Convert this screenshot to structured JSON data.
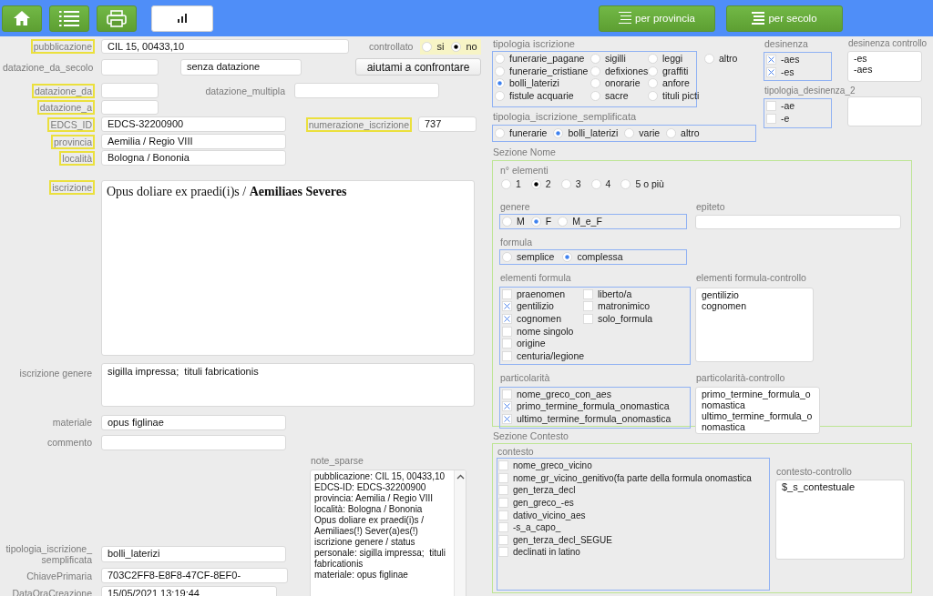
{
  "toolbar": {
    "buttons": [
      {
        "label": "per provincia"
      },
      {
        "label": "per secolo"
      }
    ]
  },
  "fields": {
    "pubblicazione": {
      "label": "pubblicazione",
      "flagged": true,
      "value": "CIL 15, 00433,10"
    },
    "controllato": {
      "label": "controllato",
      "options": [
        {
          "label": "si",
          "selected": false
        },
        {
          "label": "no",
          "selected": true
        }
      ]
    },
    "datazione_da_secolo": {
      "label": "datazione_da_secolo",
      "flagged": false,
      "extra_value": "senza datazione"
    },
    "confronta_button": "aiutami a confrontare",
    "datazione_da": {
      "label": "datazione_da",
      "flagged": true
    },
    "datazione_multipla": {
      "label": "datazione_multipla",
      "flagged": false
    },
    "datazione_a": {
      "label": "datazione_a",
      "flagged": true
    },
    "EDCS_ID": {
      "label": "EDCS_ID",
      "flagged": true,
      "value": "EDCS-32200900"
    },
    "numerazione_iscrizione": {
      "label": "numerazione_iscrizione",
      "flagged": true,
      "value": "737"
    },
    "provincia": {
      "label": "provincia",
      "flagged": true,
      "value": "Aemilia / Regio VIII"
    },
    "localita": {
      "label": "località",
      "flagged": true,
      "value": "Bologna / Bononia"
    },
    "iscrizione": {
      "label": "iscrizione",
      "flagged": true,
      "value": "Opus doliare ex praedi(i)s / **Aemiliaes Severes**"
    },
    "iscrizione_genere": {
      "label": "iscrizione genere",
      "flagged": false,
      "value": "sigilla impressa;  tituli fabricationis"
    },
    "materiale": {
      "label": "materiale",
      "flagged": false,
      "value": "opus figlinae"
    },
    "commento": {
      "label": "commento",
      "flagged": false
    },
    "note_sparse": {
      "label": "note_sparse",
      "value": "pubblicazione: CIL 15, 00433,10\tEDCS-ID: EDCS-32200900\nprovincia: Aemilia / Regio VIII\tlocalità: Bologna / Bononia\nOpus doliare ex praedi(i)s / Aemiliaes(!) Sever(a)es(!)\niscrizione genere / status personale: sigilla impressa;  tituli fabricationis\nmateriale: opus figlinae"
    },
    "tipologia_iscrizione_semplificata": {
      "label": "tipologia_iscrizione_semplificata",
      "flagged": false,
      "value": "bolli_laterizi"
    },
    "ChiavePrimaria": {
      "label": "ChiavePrimaria",
      "flagged": false,
      "value": "703C2FF8-E8F8-47CF-8EF0-"
    },
    "DataOraCreazione": {
      "label": "DataOraCreazione",
      "flagged": false,
      "value": "15/05/2021 13:19:44"
    }
  },
  "classificazione": {
    "tipologia_iscrizione": {
      "label": "tipologia iscrizione",
      "options": [
        {
          "label": "funerarie_pagane",
          "selected": false
        },
        {
          "label": "funerarie_cristiane",
          "selected": false
        },
        {
          "label": "bolli_laterizi",
          "selected": true
        },
        {
          "label": "fistule acquarie",
          "selected": false
        },
        {
          "label": "sigilli",
          "selected": false
        },
        {
          "label": "defixiones",
          "selected": false
        },
        {
          "label": "onorarie",
          "selected": false
        },
        {
          "label": "sacre",
          "selected": false
        },
        {
          "label": "leggi",
          "selected": false
        },
        {
          "label": "graffiti",
          "selected": false
        },
        {
          "label": "anfore",
          "selected": false
        },
        {
          "label": "tituli picti",
          "selected": false
        },
        {
          "label": "altro",
          "selected": false
        }
      ]
    },
    "tipologia_iscrizione_semplificata": {
      "label": "tipologia_iscrizione_semplificata",
      "options": [
        {
          "label": "funerarie",
          "selected": false
        },
        {
          "label": "bolli_laterizi",
          "selected": true
        },
        {
          "label": "varie",
          "selected": false
        },
        {
          "label": "altro",
          "selected": false
        }
      ]
    },
    "desinenza": {
      "label": "desinenza",
      "options": [
        {
          "label": "-aes",
          "checked": true
        },
        {
          "label": "-es",
          "checked": true
        }
      ]
    },
    "desinenza_controllo": {
      "label": "desinenza controllo",
      "lines": [
        "-es",
        "-aes"
      ]
    },
    "tipologia_desinenza_2": {
      "label": "tipologia_desinenza_2",
      "options": [
        {
          "label": "-ae",
          "checked": false
        },
        {
          "label": "-e",
          "checked": false
        }
      ]
    }
  },
  "sezione_nome": {
    "title": "Sezione Nome",
    "n_elementi": {
      "label": "n° elementi",
      "options": [
        {
          "label": "1",
          "selected": false
        },
        {
          "label": "2",
          "selected": true
        },
        {
          "label": "3",
          "selected": false
        },
        {
          "label": "4",
          "selected": false
        },
        {
          "label": "5 o più",
          "selected": false
        }
      ]
    },
    "genere": {
      "label": "genere",
      "options": [
        {
          "label": "M",
          "selected": false
        },
        {
          "label": "F",
          "selected": true
        },
        {
          "label": "M_e_F",
          "selected": false
        }
      ]
    },
    "epiteto": {
      "label": "epiteto"
    },
    "formula": {
      "label": "formula",
      "options": [
        {
          "label": "semplice",
          "selected": false
        },
        {
          "label": "complessa",
          "selected": true
        }
      ]
    },
    "elementi_formula": {
      "label": "elementi formula",
      "options": [
        {
          "label": "praenomen",
          "checked": false
        },
        {
          "label": "gentilizio",
          "checked": true
        },
        {
          "label": "cognomen",
          "checked": true
        },
        {
          "label": "nome singolo",
          "checked": false
        },
        {
          "label": "origine",
          "checked": false
        },
        {
          "label": "centuria/legione",
          "checked": false
        },
        {
          "label": "liberto/a",
          "checked": false
        },
        {
          "label": "matronimico",
          "checked": false
        },
        {
          "label": "solo_formula",
          "checked": false
        }
      ]
    },
    "elementi_formula_controllo": {
      "label": "elementi formula-controllo",
      "lines": [
        "gentilizio",
        "cognomen"
      ]
    },
    "particolarita": {
      "label": "particolarità",
      "options": [
        {
          "label": "nome_greco_con_aes",
          "checked": false
        },
        {
          "label": "primo_termine_formula_onomastica",
          "checked": true
        },
        {
          "label": "ultimo_termine_formula_onomastica",
          "checked": true
        }
      ]
    },
    "particolarita_controllo": {
      "label": "particolarità-controllo",
      "lines": [
        "primo_termine_formula_onomastica",
        "ultimo_termine_formula_onomastica"
      ]
    }
  },
  "sezione_contesto": {
    "title": "Sezione Contesto",
    "contesto": {
      "label": "contesto",
      "options": [
        {
          "label": "nome_greco_vicino",
          "checked": false
        },
        {
          "label": "nome_gr_vicino_genitivo(fa parte della formula onomastica",
          "checked": false
        },
        {
          "label": "gen_terza_decl",
          "checked": false
        },
        {
          "label": "gen_greco_-es",
          "checked": false
        },
        {
          "label": "dativo_vicino_aes",
          "checked": false
        },
        {
          "label": "-s_a_capo_",
          "checked": false
        },
        {
          "label": "gen_terza_decl_SEGUE",
          "checked": false
        },
        {
          "label": "declinati in latino",
          "checked": false
        }
      ]
    },
    "contesto_controllo": {
      "label": "contesto-controllo",
      "lines": [
        "$_s_contestuale"
      ]
    }
  }
}
